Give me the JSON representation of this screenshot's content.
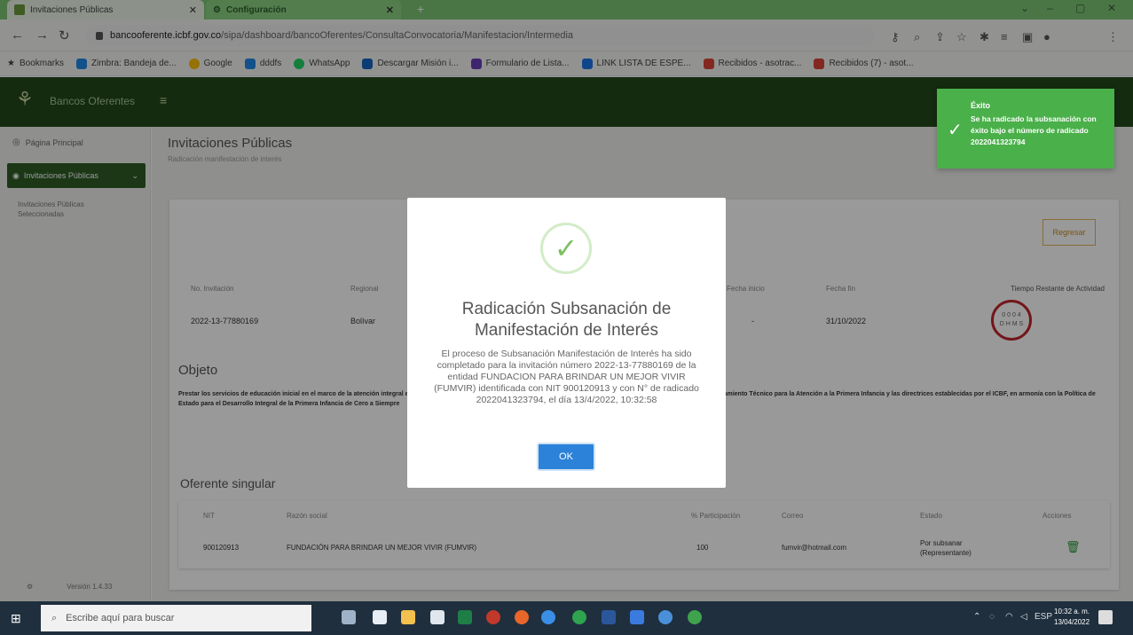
{
  "browser": {
    "tabs": [
      {
        "label": "Invitaciones Públicas"
      },
      {
        "label": "Configuración"
      }
    ],
    "url_host": "bancooferente.icbf.gov.co",
    "url_path": "/sipa/dashboard/bancoOferentes/ConsultaConvocatoria/Manifestacion/Intermedia",
    "bookmarks": [
      {
        "label": "Bookmarks",
        "color": "#555555"
      },
      {
        "label": "Zimbra: Bandeja de...",
        "color": "#1e88e5"
      },
      {
        "label": "Google",
        "color": "#fbbc05"
      },
      {
        "label": "dddfs",
        "color": "#1e88e5"
      },
      {
        "label": "WhatsApp",
        "color": "#25d366"
      },
      {
        "label": "Descargar Misión i...",
        "color": "#1565c0"
      },
      {
        "label": "Formulario de Lista...",
        "color": "#6a3fb8"
      },
      {
        "label": "LINK LISTA DE ESPE...",
        "color": "#1a73e8"
      },
      {
        "label": "Recibidos - asotrac...",
        "color": "#db4437"
      },
      {
        "label": "Recibidos (7) - asot...",
        "color": "#db4437"
      }
    ]
  },
  "app": {
    "brand": "Bancos Oferentes",
    "sidebar": {
      "home": "Página Principal",
      "active": "Invitaciones Públicas",
      "sub": "Invitaciones Públicas Seleccionadas",
      "version_icon": "⚙",
      "version": "Versión 1.4.33"
    },
    "page_title": "Invitaciones Públicas",
    "page_subtitle": "Radicación manifestación de interés",
    "regresar": "Regresar",
    "headers": {
      "invitacion": "No. Invitación",
      "regional": "Regional",
      "fecha_inicio": "Fecha inicio",
      "fecha_fin": "Fecha fin",
      "tiempo": "Tiempo Restante de Actividad"
    },
    "values": {
      "invitacion": "2022-13-77880169",
      "regional": "Bolívar",
      "fecha_inicio": "-",
      "fecha_fin": "31/10/2022"
    },
    "timer": {
      "line1": "0 0 0 4",
      "line2": "D H M S"
    },
    "objeto_label": "Objeto",
    "objeto_text": "Prestar los servicios de educación inicial en el marco de la atención integral en la modalidad Institucional, de conformidad con el Manual Operativo de la Modalidad Institucional, el Lineamiento Técnico para la Atención a la Primera Infancia y las directrices establecidas por el ICBF, en armonía con la Política de Estado para el Desarrollo Integral de la Primera Infancia de Cero a Siempre",
    "oferente_label": "Oferente singular",
    "oferente_headers": [
      "NIT",
      "Razón social",
      "% Participación",
      "Correo",
      "Estado",
      "Acciones"
    ],
    "oferente_row": {
      "nit": "900120913",
      "razon": "FUNDACIÓN PARA BRINDAR UN MEJOR VIVIR (FUMVIR)",
      "participacion": "100",
      "correo": "fumvir@hotmail.com",
      "estado_1": "Por subsanar",
      "estado_2": "(Representante)"
    }
  },
  "modal": {
    "title": "Radicación Subsanación de Manifestación de Interés",
    "body": "El proceso de Subsanación Manifestación de Interés ha sido completado para la invitación número 2022-13-77880169 de la entidad FUNDACION PARA BRINDAR UN MEJOR VIVIR (FUMVIR) identificada con NIT 900120913 y con N° de radicado 202204132379​4, el día 13/4/2022, 10:32:58",
    "ok": "OK"
  },
  "toast": {
    "title": "Éxito",
    "body": "Se ha radicado la subsanación con éxito bajo el número de radicado 202204132379​4"
  },
  "taskbar": {
    "search_placeholder": "Escribe aquí para buscar",
    "lang": "ESP",
    "time": "10:32 a. m.",
    "date": "13/04/2022"
  },
  "colors": {
    "tab_green": "#7cc576",
    "header_dark_green": "#22491c",
    "sidebar_active": "#2d5d26",
    "toast_green": "#4ab04a",
    "ok_blue": "#2b82d8",
    "timer_red": "#c0262c"
  }
}
